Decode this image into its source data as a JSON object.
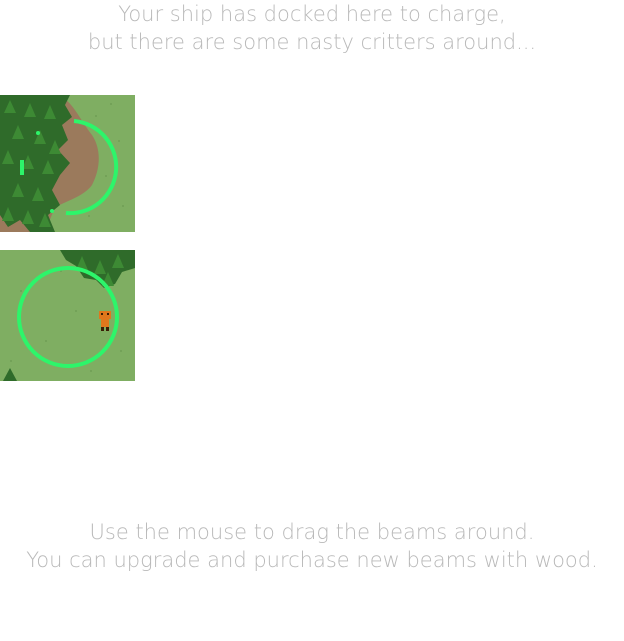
{
  "intro_message": {
    "line1": "Your ship has docked here to charge,",
    "line2": "but there are some nasty critters around..."
  },
  "help_message": {
    "line1": "Use the mouse to drag the beams around.",
    "line2": "You can upgrade and purchase new beams with wood."
  },
  "colors": {
    "grass": "#7fae62",
    "grass_dark": "#6f9e55",
    "dirt": "#9b7a5c",
    "tree": "#2f6b2a",
    "tree_light": "#3d8a34",
    "beam": "#2df56a",
    "critter": "#e0771c",
    "text": "#b9b9b9"
  },
  "tiles": [
    {
      "name": "beam-tile-forest",
      "beam": "partial-ring"
    },
    {
      "name": "beam-tile-critter",
      "beam": "full-ring",
      "critter": "orange-critter"
    }
  ]
}
